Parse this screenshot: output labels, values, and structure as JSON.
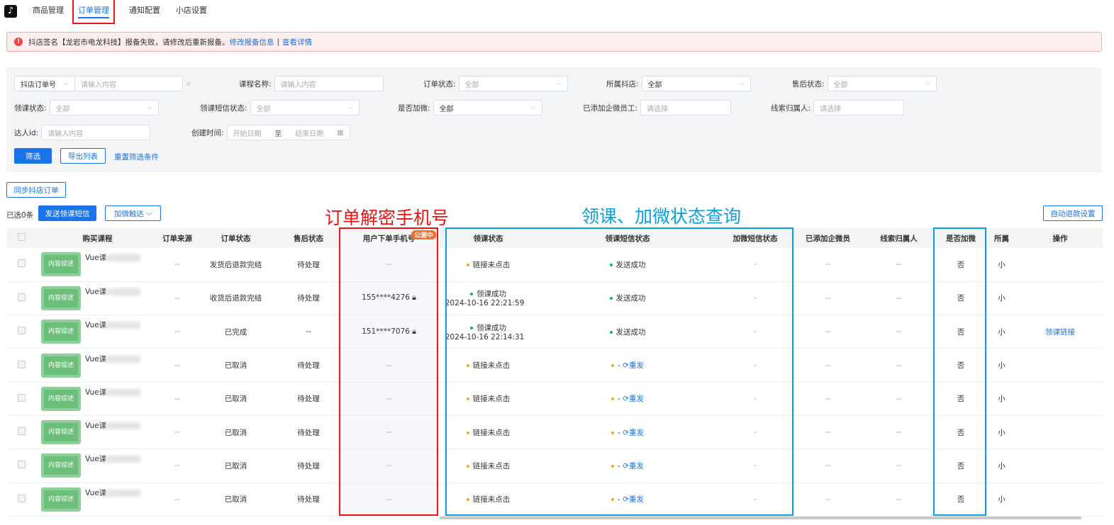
{
  "nav": {
    "items": [
      "商品管理",
      "订单管理",
      "通知配置",
      "小店设置"
    ],
    "active": 1
  },
  "alert": {
    "text": "抖店签名【龙岩市电龙科技】报备失败，请修改后重新报备。",
    "link1": "修改报备信息",
    "sep": "|",
    "link2": "查看详情"
  },
  "filters": {
    "order_no_type": "抖店订单号",
    "order_no_ph": "请输入内容",
    "course_label": "课程名称:",
    "course_ph": "请输入内容",
    "order_status_label": "订单状态:",
    "order_status": "全部",
    "shop_label": "所属抖店:",
    "shop": "全部",
    "after_label": "售后状态:",
    "after": "全部",
    "claim_label": "领课状态:",
    "claim": "全部",
    "sms_label": "领课短信状态:",
    "sms": "全部",
    "wx_label": "是否加微:",
    "wx": "全部",
    "staff_label": "已添加企微员工:",
    "staff_ph": "请选择",
    "owner_label": "线索归属人:",
    "owner_ph": "请选择",
    "talent_label": "达人id:",
    "talent_ph": "请输入内容",
    "created_label": "创建时间:",
    "start_ph": "开始日期",
    "to": "至",
    "end_ph": "结束日期",
    "filter_btn": "筛选",
    "export_btn": "导出列表",
    "reset_link": "重置筛选条件"
  },
  "toolbar": {
    "sync": "同步抖店订单",
    "selected": "已选0条",
    "send_sms": "发送领课短信",
    "add_wx": "加微触达",
    "auto_refund": "自动退款设置"
  },
  "annotations": {
    "phone": "订单解密手机号",
    "status": "领课、加微状态查询"
  },
  "table": {
    "headers": [
      "购买课程",
      "订单来源",
      "订单状态",
      "售后状态",
      "用户下单手机号",
      "领课状态",
      "领课短信状态",
      "加微短信状态",
      "已添加企微员",
      "线索归属人",
      "是否加微",
      "所属",
      "操作"
    ],
    "beta_badge": "公测中",
    "thumb_text": "内容综述",
    "rows": [
      {
        "course": "Vue课",
        "source": "--",
        "status": "发货后退款完结",
        "after": "待处理",
        "phone": "--",
        "lock": false,
        "claim": "链接未点击",
        "claim_color": "orange",
        "claim_time": "",
        "sms": "发送成功",
        "sms_color": "green",
        "resend": "",
        "wxsms": "-",
        "staff": "--",
        "owner": "--",
        "wx": "否",
        "shop": "小",
        "action": ""
      },
      {
        "course": "Vue课",
        "source": "--",
        "status": "收货后退款完结",
        "after": "待处理",
        "phone": "155****4276",
        "lock": true,
        "claim": "领课成功",
        "claim_color": "green",
        "claim_time": "2024-10-16 22:21:59",
        "sms": "发送成功",
        "sms_color": "green",
        "resend": "",
        "wxsms": "-",
        "staff": "--",
        "owner": "--",
        "wx": "否",
        "shop": "小",
        "action": ""
      },
      {
        "course": "Vue课",
        "source": "--",
        "status": "已完成",
        "after": "--",
        "phone": "151****7076",
        "lock": true,
        "claim": "领课成功",
        "claim_color": "green",
        "claim_time": "2024-10-16 22:14:31",
        "sms": "发送成功",
        "sms_color": "green",
        "resend": "",
        "wxsms": "-",
        "staff": "--",
        "owner": "--",
        "wx": "否",
        "shop": "小",
        "action": "领课链接"
      },
      {
        "course": "Vue课",
        "source": "--",
        "status": "已取消",
        "after": "待处理",
        "phone": "--",
        "lock": false,
        "claim": "链接未点击",
        "claim_color": "orange",
        "claim_time": "",
        "sms": "-",
        "sms_color": "orange",
        "resend": "重发",
        "wxsms": "-",
        "staff": "--",
        "owner": "--",
        "wx": "否",
        "shop": "小",
        "action": ""
      },
      {
        "course": "Vue课",
        "source": "--",
        "status": "已取消",
        "after": "待处理",
        "phone": "--",
        "lock": false,
        "claim": "链接未点击",
        "claim_color": "orange",
        "claim_time": "",
        "sms": "-",
        "sms_color": "orange",
        "resend": "重发",
        "wxsms": "-",
        "staff": "--",
        "owner": "--",
        "wx": "否",
        "shop": "小",
        "action": ""
      },
      {
        "course": "Vue课",
        "source": "--",
        "status": "已取消",
        "after": "待处理",
        "phone": "--",
        "lock": false,
        "claim": "链接未点击",
        "claim_color": "orange",
        "claim_time": "",
        "sms": "-",
        "sms_color": "orange",
        "resend": "重发",
        "wxsms": "-",
        "staff": "--",
        "owner": "--",
        "wx": "否",
        "shop": "小",
        "action": ""
      },
      {
        "course": "Vue课",
        "source": "--",
        "status": "已取消",
        "after": "待处理",
        "phone": "--",
        "lock": false,
        "claim": "链接未点击",
        "claim_color": "orange",
        "claim_time": "",
        "sms": "-",
        "sms_color": "orange",
        "resend": "重发",
        "wxsms": "-",
        "staff": "--",
        "owner": "--",
        "wx": "否",
        "shop": "小",
        "action": ""
      },
      {
        "course": "Vue课",
        "source": "--",
        "status": "已取消",
        "after": "待处理",
        "phone": "--",
        "lock": false,
        "claim": "链接未点击",
        "claim_color": "orange",
        "claim_time": "",
        "sms": "-",
        "sms_color": "orange",
        "resend": "重发",
        "wxsms": "-",
        "staff": "--",
        "owner": "--",
        "wx": "否",
        "shop": "小",
        "action": ""
      }
    ]
  }
}
